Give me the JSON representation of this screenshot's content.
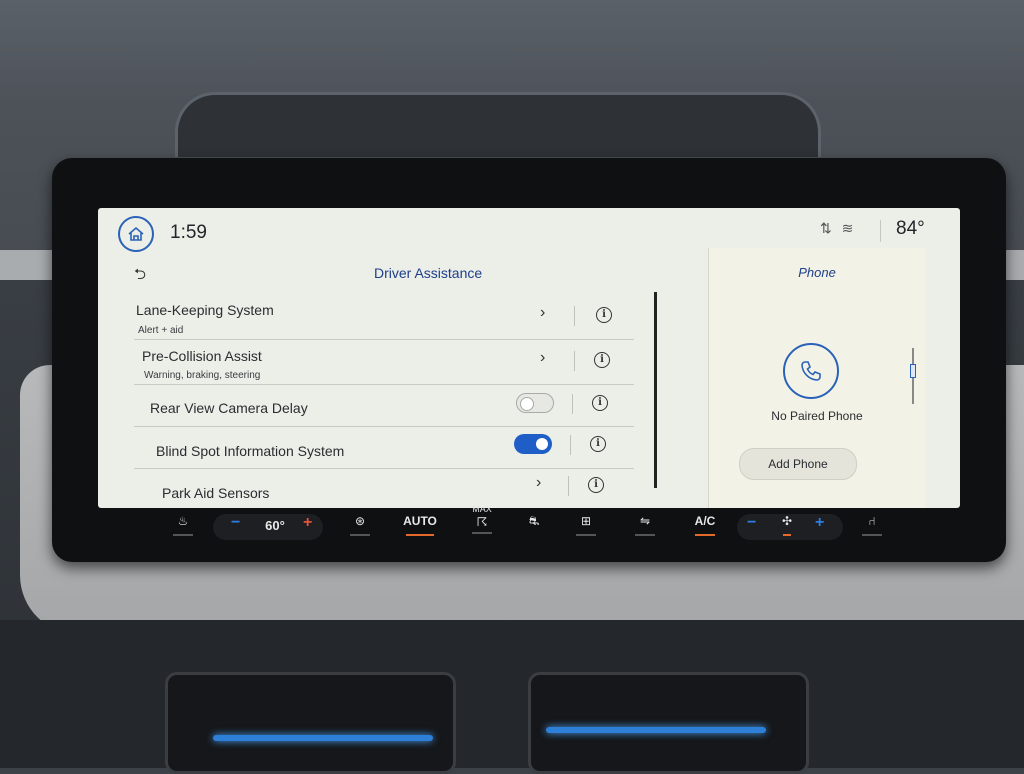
{
  "status": {
    "time": "1:59",
    "temperature": "84°"
  },
  "panel": {
    "title": "Driver Assistance",
    "items": [
      {
        "label": "Lane-Keeping System",
        "sublabel": "Alert + aid",
        "control": "chevron"
      },
      {
        "label": "Pre-Collision Assist",
        "sublabel": "Warning, braking, steering",
        "control": "chevron"
      },
      {
        "label": "Rear View Camera Delay",
        "control": "toggle",
        "state": "off"
      },
      {
        "label": "Blind Spot Information System",
        "control": "toggle",
        "state": "on"
      },
      {
        "label": "Park Aid Sensors",
        "control": "chevron"
      }
    ]
  },
  "phone": {
    "title": "Phone",
    "status": "No Paired Phone",
    "add_button": "Add Phone"
  },
  "climate": {
    "temp": "60°",
    "auto_label": "AUTO",
    "max_label": "MAX",
    "ac_label": "A/C"
  },
  "colors": {
    "accent": "#1e5ec6",
    "title_blue": "#1e3f8a",
    "indicator_orange": "#e46a2b"
  },
  "icons": [
    "home-icon",
    "back-arrow-icon",
    "chevron-right-icon",
    "info-icon",
    "phone-icon",
    "wifi-icon",
    "signal-icon",
    "seat-heat-icon",
    "steering-heat-icon",
    "max-defrost-icon",
    "driver-assist-icon",
    "rear-defrost-icon",
    "recirculation-icon",
    "fan-icon",
    "seat-icon"
  ]
}
